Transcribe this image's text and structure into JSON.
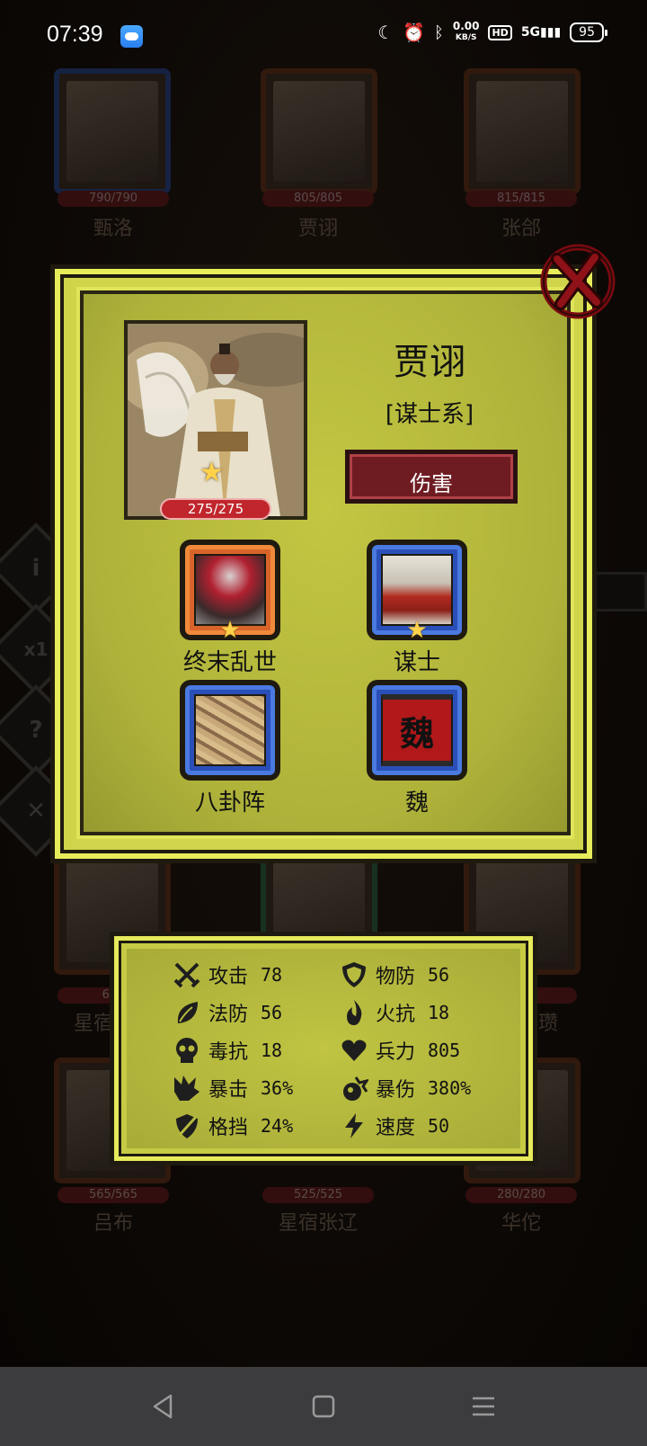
{
  "status_bar": {
    "time": "07:39",
    "net_speed": "0.00",
    "net_unit": "KB/S",
    "hd": "HD",
    "signal": "5G",
    "battery": "95"
  },
  "background": {
    "cards": [
      {
        "name": "甄洛",
        "hp": "790/790"
      },
      {
        "name": "贾诩",
        "hp": "805/805"
      },
      {
        "name": "张郃",
        "hp": "815/815"
      },
      {
        "name": "星宿",
        "hp": "640"
      },
      {
        "name": "",
        "hp": ""
      },
      {
        "name": "瓒",
        "hp": "580"
      },
      {
        "name": "吕布",
        "hp": "565/565"
      },
      {
        "name": "星宿张辽",
        "hp": "525/525"
      },
      {
        "name": "华佗",
        "hp": "280/280"
      }
    ],
    "side_buttons": [
      "i",
      "x1",
      "?",
      "✕"
    ]
  },
  "hero": {
    "name": "贾诩",
    "class": "[谋士系]",
    "hp": "275/275",
    "type_button": "伤害",
    "stars": 1
  },
  "traits": [
    {
      "label": "终末乱世",
      "frame": "orange",
      "stars": 1
    },
    {
      "label": "谋士",
      "frame": "blue",
      "stars": 1
    },
    {
      "label": "八卦阵",
      "frame": "blue",
      "stars": 0
    },
    {
      "label": "魏",
      "frame": "blue",
      "stars": 0,
      "emblem": "魏"
    }
  ],
  "stats": [
    {
      "icon": "crossed-swords-icon",
      "label": "攻击",
      "value": "78"
    },
    {
      "icon": "shield-icon",
      "label": "物防",
      "value": "56"
    },
    {
      "icon": "leaf-icon",
      "label": "法防",
      "value": "56"
    },
    {
      "icon": "fire-icon",
      "label": "火抗",
      "value": "18"
    },
    {
      "icon": "skull-icon",
      "label": "毒抗",
      "value": "18"
    },
    {
      "icon": "heart-icon",
      "label": "兵力",
      "value": "805"
    },
    {
      "icon": "critical-icon",
      "label": "暴击",
      "value": "36%"
    },
    {
      "icon": "critical-damage-icon",
      "label": "暴伤",
      "value": "380%"
    },
    {
      "icon": "block-icon",
      "label": "格挡",
      "value": "24%"
    },
    {
      "icon": "lightning-icon",
      "label": "速度",
      "value": "50"
    }
  ]
}
